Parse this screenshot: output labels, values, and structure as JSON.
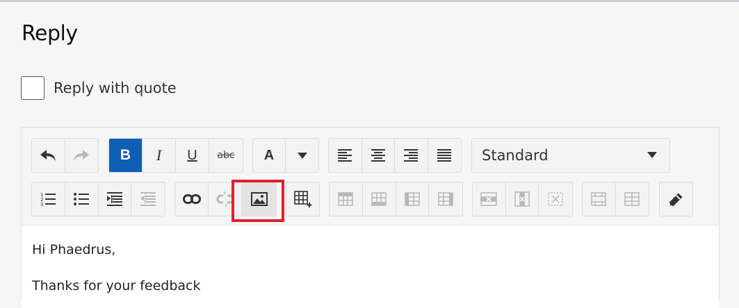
{
  "page": {
    "title": "Reply",
    "reply_with_quote_label": "Reply with quote"
  },
  "toolbar": {
    "format_select": {
      "value": "Standard"
    },
    "bold_label": "B",
    "italic_label": "I",
    "underline_label": "U",
    "strikethrough_label": "abc",
    "font_color_label": "A"
  },
  "editor": {
    "lines": [
      "Hi Phaedrus,",
      "Thanks for your feedback"
    ]
  },
  "colors": {
    "accent": "#0f5eb5",
    "highlight_border": "#e0202a"
  }
}
